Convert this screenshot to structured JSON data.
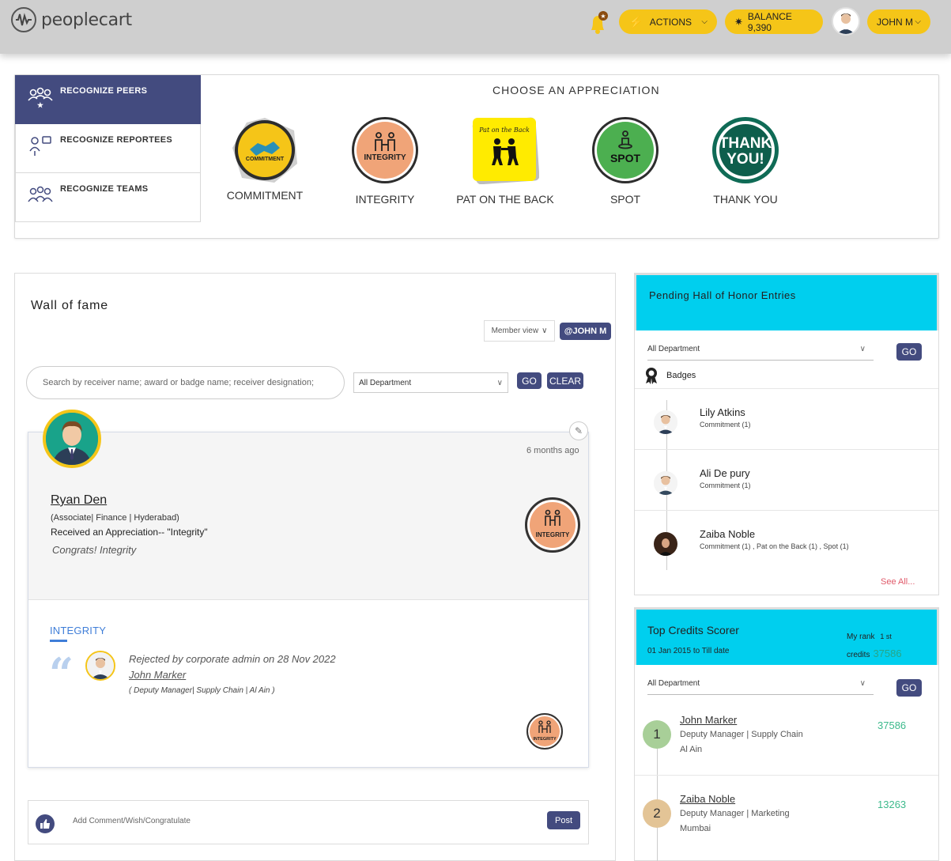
{
  "header": {
    "logo_text": "peoplecart",
    "actions_label": "ACTIONS",
    "balance_label": "BALANCE 9,390",
    "user_label": "JOHN M"
  },
  "appreciation": {
    "title": "CHOOSE AN APPRECIATION",
    "tabs": [
      {
        "label": "RECOGNIZE PEERS",
        "active": true
      },
      {
        "label": "RECOGNIZE REPORTEES",
        "active": false
      },
      {
        "label": "RECOGNIZE TEAMS",
        "active": false
      }
    ],
    "badges": [
      {
        "label": "COMMITMENT",
        "inner": "COMMITMENT",
        "color": "#f5c518"
      },
      {
        "label": "INTEGRITY",
        "inner": "INTEGRITY",
        "color": "#f0a478"
      },
      {
        "label": "PAT ON THE BACK",
        "inner": "Pat on the Back",
        "color": "#ffeb00"
      },
      {
        "label": "SPOT",
        "inner": "SPOT",
        "color": "#4caf50"
      },
      {
        "label": "THANK YOU",
        "inner_line1": "THANK",
        "inner_line2": "YOU!",
        "color": "#0f6b56"
      }
    ]
  },
  "wall": {
    "title": "Wall of fame",
    "member_view": "Member view",
    "at_user": "@JOHN M",
    "search_placeholder": "Search by receiver name; award or badge name; receiver designation;",
    "dept": "All Department",
    "go": "GO",
    "clear": "CLEAR",
    "post": {
      "time": "6 months ago",
      "name": "Ryan Den",
      "meta": "(Associate| Finance | Hyderabad)",
      "received": "Received an Appreciation-- \"Integrity\"",
      "congrats": "Congrats! Integrity",
      "badge_text": "INTEGRITY",
      "tag": "INTEGRITY",
      "rejected": "Rejected by corporate admin on 28 Nov 2022",
      "rejected_by": "John Marker",
      "rejected_meta": "( Deputy Manager| Supply Chain | Al Ain )"
    },
    "comment_placeholder": "Add Comment/Wish/Congratulate",
    "post_btn": "Post"
  },
  "hall": {
    "title": "Pending Hall of Honor Entries",
    "dept": "All Department",
    "go": "GO",
    "badges_label": "Badges",
    "entries": [
      {
        "name": "Lily Atkins",
        "sub": "Commitment (1)"
      },
      {
        "name": "Ali De pury",
        "sub": "Commitment (1)"
      },
      {
        "name": "Zaiba Noble",
        "sub": "Commitment (1) , Pat on the Back (1) , Spot (1)"
      }
    ],
    "see_all": "See All..."
  },
  "scorer": {
    "title": "Top Credits Scorer",
    "date": "01 Jan 2015 to Till date",
    "myrank_label": "My rank",
    "myrank_value": "1 st",
    "credits_label": "credits",
    "credits_value": "37586",
    "dept": "All Department",
    "go": "GO",
    "entries": [
      {
        "rank": "1",
        "name": "John Marker",
        "role": "Deputy Manager | Supply Chain",
        "loc": "Al Ain",
        "points": "37586",
        "color": "#a8cf98"
      },
      {
        "rank": "2",
        "name": "Zaiba Noble",
        "role": "Deputy Manager | Marketing",
        "loc": "Mumbai",
        "points": "13263",
        "color": "#e3c496"
      }
    ]
  }
}
